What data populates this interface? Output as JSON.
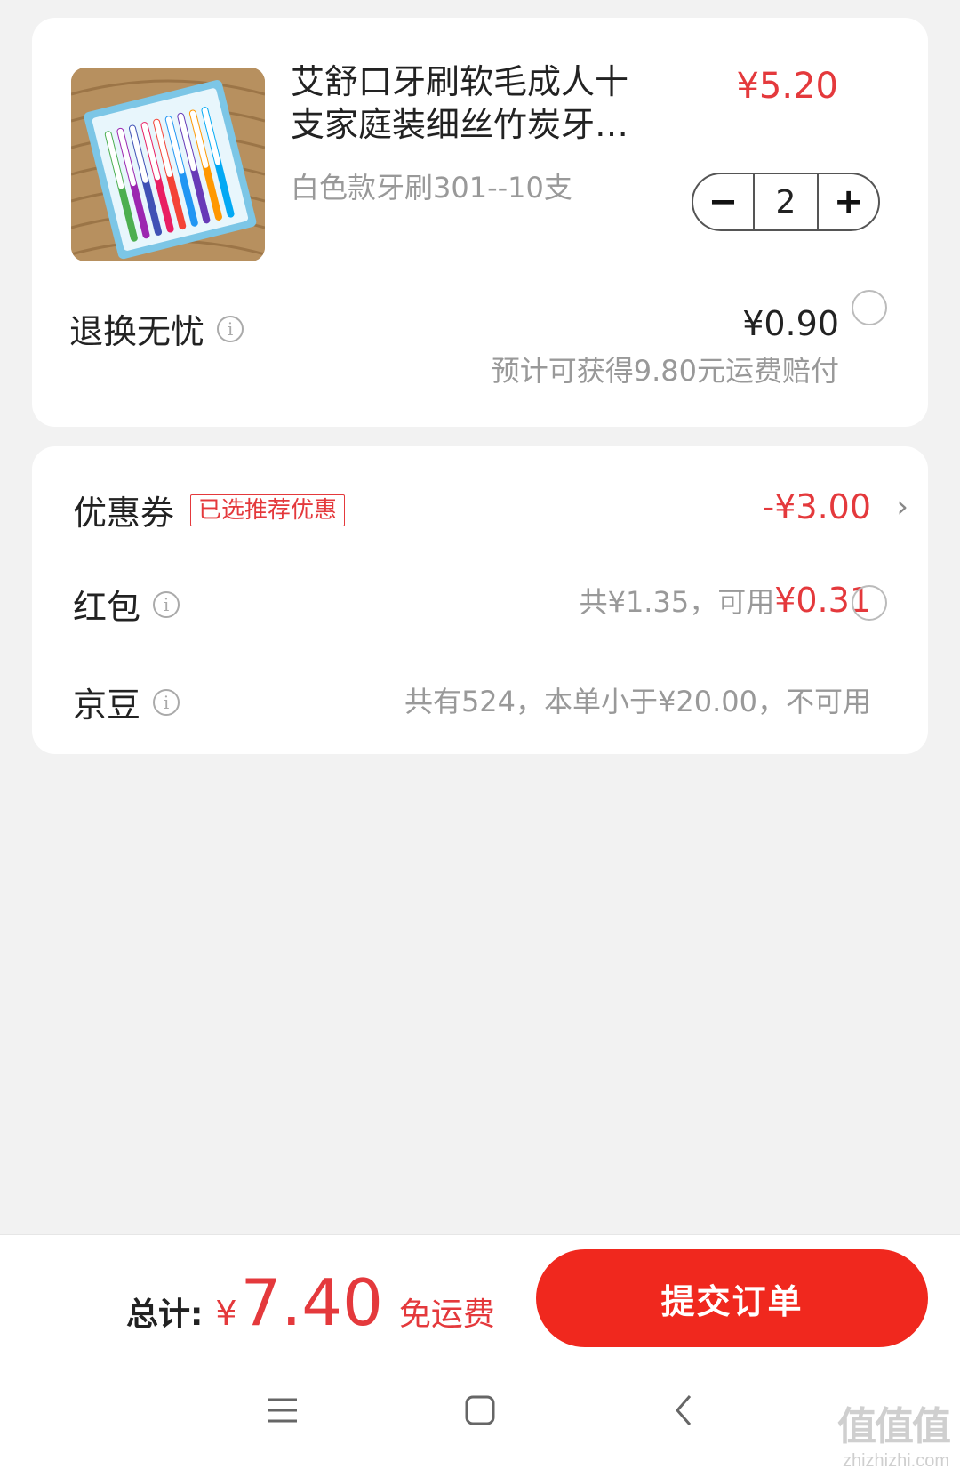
{
  "product": {
    "title_line1": "艾舒口牙刷软毛成人十",
    "title_line2": "支家庭装细丝竹炭牙…",
    "spec": "白色款牙刷301--10支",
    "price": "¥5.20",
    "quantity": "2",
    "minus": "−",
    "plus": "+",
    "image_icon": "toothbrush-pack-image"
  },
  "return_service": {
    "label": "退换无忧",
    "price": "¥0.90",
    "note": "预计可获得9.80元运费赔付"
  },
  "coupon": {
    "label": "优惠券",
    "tag": "已选推荐优惠",
    "value": "-¥3.00"
  },
  "red_packet": {
    "label": "红包",
    "total_text": "共¥1.35，可用",
    "usable": "¥0.31"
  },
  "jd_beans": {
    "label": "京豆",
    "text": "共有524，本单小于¥20.00，不可用"
  },
  "footer": {
    "total_label": "总计:",
    "currency": "¥",
    "total_amount": "7.40",
    "shipping": "免运费",
    "submit_label": "提交订单"
  },
  "watermark": {
    "main": "值值值",
    "sub": "zhizhizhi.com"
  },
  "colors": {
    "accent": "#e4393c",
    "submit": "#f0281e"
  }
}
